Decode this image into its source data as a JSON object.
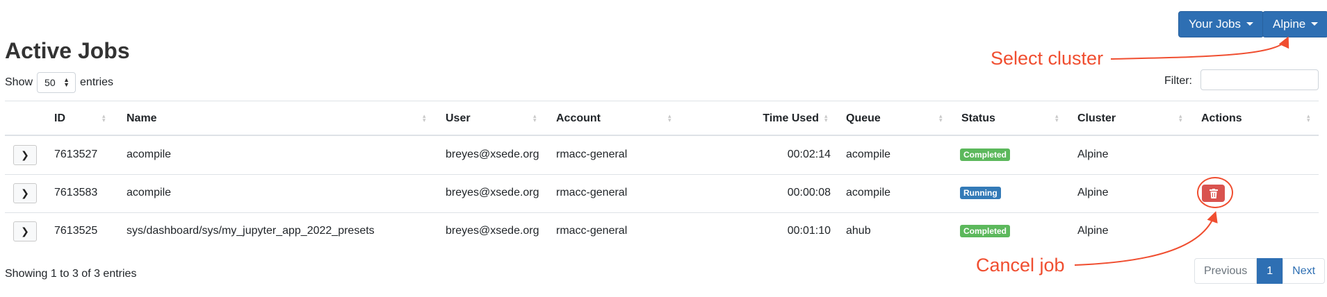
{
  "top_buttons": {
    "jobs_filter": "Your Jobs",
    "cluster_select": "Alpine"
  },
  "page_title": "Active Jobs",
  "length": {
    "show": "Show",
    "value": "50",
    "entries": "entries"
  },
  "filter": {
    "label": "Filter:",
    "value": ""
  },
  "table": {
    "headers": [
      "ID",
      "Name",
      "User",
      "Account",
      "Time Used",
      "Queue",
      "Status",
      "Cluster",
      "Actions"
    ],
    "rows": [
      {
        "id": "7613527",
        "name": "acompile",
        "user": "breyes@xsede.org",
        "account": "rmacc-general",
        "time": "00:02:14",
        "queue": "acompile",
        "status": "Completed",
        "cluster": "Alpine",
        "can_cancel": false
      },
      {
        "id": "7613583",
        "name": "acompile",
        "user": "breyes@xsede.org",
        "account": "rmacc-general",
        "time": "00:00:08",
        "queue": "acompile",
        "status": "Running",
        "cluster": "Alpine",
        "can_cancel": true
      },
      {
        "id": "7613525",
        "name": "sys/dashboard/sys/my_jupyter_app_2022_presets",
        "user": "breyes@xsede.org",
        "account": "rmacc-general",
        "time": "00:01:10",
        "queue": "ahub",
        "status": "Completed",
        "cluster": "Alpine",
        "can_cancel": false
      }
    ]
  },
  "info_text": "Showing 1 to 3 of 3 entries",
  "pagination": {
    "previous": "Previous",
    "current": "1",
    "next": "Next"
  },
  "annotations": {
    "select_cluster": "Select cluster",
    "cancel_job": "Cancel job"
  },
  "colors": {
    "primary": "#2e6fb3",
    "completed": "#5cb85c",
    "running": "#337ab7",
    "danger": "#d9534f",
    "annotation": "#f04e30"
  }
}
